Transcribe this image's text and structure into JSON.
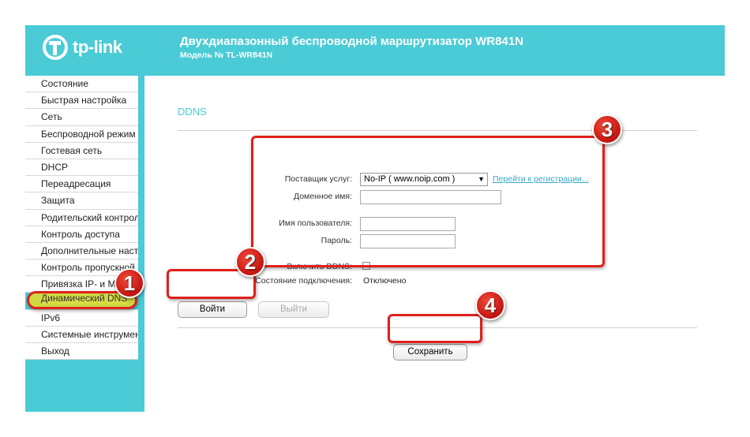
{
  "header": {
    "logo_text": "tp-link",
    "title": "Двухдиапазонный беспроводной маршрутизатор WR841N",
    "model": "Модель № TL-WR841N"
  },
  "menu": {
    "items": [
      "Состояние",
      "Быстрая настройка",
      "Сеть",
      "Беспроводной режим",
      "Гостевая сеть",
      "DHCP",
      "Переадресация",
      "Защита",
      "Родительский контроль",
      "Контроль доступа",
      "Дополнительные настр",
      "Контроль пропускной",
      "Привязка IP- и М",
      "Динамический DNS",
      "IPv6",
      "Системные инструмент",
      "Выход"
    ],
    "active_index": 13
  },
  "ddns": {
    "section_title": "DDNS",
    "provider_label": "Поставщик услуг:",
    "provider_value": "No-IP ( www.noip.com )",
    "register_link": "Перейти к регистрации...",
    "domain_label": "Доменное имя:",
    "domain_value": "",
    "username_label": "Имя пользователя:",
    "username_value": "",
    "password_label": "Пароль:",
    "password_value": "",
    "enable_label": "Включить DDNS:",
    "status_label": "Состояние подключения:",
    "status_value": "Отключено",
    "login_button": "Войти",
    "logout_button": "Выйти",
    "save_button": "Сохранить"
  },
  "annotations": {
    "step1": "1",
    "step2": "2",
    "step3": "3",
    "step4": "4"
  },
  "colors": {
    "brand": "#4acbd6",
    "annotation": "#e0201b"
  }
}
